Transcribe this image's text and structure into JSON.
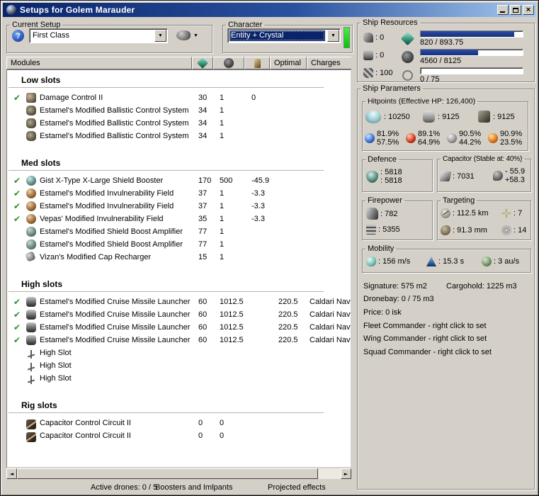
{
  "window": {
    "title": "Setups for Golem Marauder"
  },
  "colors": {
    "title_gradient_start": "#0a246a",
    "title_gradient_end": "#a6caf0",
    "selection": "#0a246a",
    "progress_fill": "#1c3c94",
    "status_green": "#00c800",
    "check_green": "#2e8f2e",
    "window_bg": "#d4d0c8"
  },
  "current_setup": {
    "label": "Current Setup",
    "value": "First Class"
  },
  "character": {
    "label": "Character",
    "value": "Entity + Crystal"
  },
  "columns": {
    "modules": "Modules",
    "optimal": "Optimal",
    "charges": "Charges"
  },
  "modules": {
    "check_glyph": "✔",
    "sections": [
      {
        "title": "Low slots",
        "rows": [
          {
            "fitted": true,
            "icon": "damage-control",
            "name": "Damage Control II",
            "cpu": "30",
            "pg": "1",
            "cap": "0"
          },
          {
            "fitted": false,
            "icon": "ballistic-control",
            "name": "Estamel's Modified Ballistic Control System",
            "cpu": "34",
            "pg": "1"
          },
          {
            "fitted": false,
            "icon": "ballistic-control",
            "name": "Estamel's Modified Ballistic Control System",
            "cpu": "34",
            "pg": "1"
          },
          {
            "fitted": false,
            "icon": "ballistic-control",
            "name": "Estamel's Modified Ballistic Control System",
            "cpu": "34",
            "pg": "1"
          }
        ]
      },
      {
        "title": "Med slots",
        "rows": [
          {
            "fitted": true,
            "icon": "shield-booster",
            "name": "Gist X-Type X-Large Shield Booster",
            "cpu": "170",
            "pg": "500",
            "cap": "-45.9"
          },
          {
            "fitted": true,
            "icon": "invuln-field",
            "name": "Estamel's Modified Invulnerability Field",
            "cpu": "37",
            "pg": "1",
            "cap": "-3.3"
          },
          {
            "fitted": true,
            "icon": "invuln-field",
            "name": "Estamel's Modified Invulnerability Field",
            "cpu": "37",
            "pg": "1",
            "cap": "-3.3"
          },
          {
            "fitted": true,
            "icon": "invuln-field",
            "name": "Vepas' Modified Invulnerability Field",
            "cpu": "35",
            "pg": "1",
            "cap": "-3.3"
          },
          {
            "fitted": false,
            "icon": "boost-amplifier",
            "name": "Estamel's Modified Shield Boost Amplifier",
            "cpu": "77",
            "pg": "1"
          },
          {
            "fitted": false,
            "icon": "boost-amplifier",
            "name": "Estamel's Modified Shield Boost Amplifier",
            "cpu": "77",
            "pg": "1"
          },
          {
            "fitted": false,
            "icon": "cap-recharger",
            "name": "Vizan's Modified Cap Recharger",
            "cpu": "15",
            "pg": "1"
          }
        ]
      },
      {
        "title": "High slots",
        "rows": [
          {
            "fitted": true,
            "icon": "missile-launcher",
            "name": "Estamel's Modified Cruise Missile Launcher",
            "cpu": "60",
            "pg": "1012.5",
            "optimal": "220.5",
            "charge": "Caldari Navy"
          },
          {
            "fitted": true,
            "icon": "missile-launcher",
            "name": "Estamel's Modified Cruise Missile Launcher",
            "cpu": "60",
            "pg": "1012.5",
            "optimal": "220.5",
            "charge": "Caldari Navy"
          },
          {
            "fitted": true,
            "icon": "missile-launcher",
            "name": "Estamel's Modified Cruise Missile Launcher",
            "cpu": "60",
            "pg": "1012.5",
            "optimal": "220.5",
            "charge": "Caldari Navy"
          },
          {
            "fitted": true,
            "icon": "missile-launcher",
            "name": "Estamel's Modified Cruise Missile Launcher",
            "cpu": "60",
            "pg": "1012.5",
            "optimal": "220.5",
            "charge": "Caldari Navy"
          },
          {
            "fitted": false,
            "icon": "empty-slot",
            "name": "High Slot"
          },
          {
            "fitted": false,
            "icon": "empty-slot",
            "name": "High Slot"
          },
          {
            "fitted": false,
            "icon": "empty-slot",
            "name": "High Slot"
          }
        ]
      },
      {
        "title": "Rig slots",
        "rows": [
          {
            "fitted": false,
            "icon": "rig",
            "name": "Capacitor Control Circuit II",
            "cpu": "0",
            "pg": "0"
          },
          {
            "fitted": false,
            "icon": "rig",
            "name": "Capacitor Control Circuit II",
            "cpu": "0",
            "pg": "0"
          }
        ]
      }
    ]
  },
  "ship_resources": {
    "label": "Ship Resources",
    "hardpoints": [
      {
        "icon": "turret-hardpoint",
        "value": ": 0"
      },
      {
        "icon": "launcher-hardpoint",
        "value": ": 0"
      },
      {
        "icon": "rigpoints",
        "value": ": 100"
      }
    ],
    "bars": [
      {
        "icon": "cpu",
        "text": "820 / 893.75",
        "pct": 91.7
      },
      {
        "icon": "powergrid",
        "text": "4560 / 8125",
        "pct": 56.1
      },
      {
        "icon": "calibration",
        "text": "0 / 75",
        "pct": 0
      }
    ]
  },
  "ship_parameters": {
    "label": "Ship Parameters",
    "hitpoints": {
      "label": "Hitpoints (Effective HP: 126,400)",
      "shield": ": 10250",
      "armor": ": 9125",
      "structure": ": 9125",
      "resists": [
        {
          "name": "em",
          "shield": "81.9%",
          "armor": "57.5%"
        },
        {
          "name": "thermal",
          "shield": "89.1%",
          "armor": "64.9%"
        },
        {
          "name": "kinetic",
          "shield": "90.5%",
          "armor": "44.2%"
        },
        {
          "name": "explosive",
          "shield": "90.9%",
          "armor": "23.5%"
        }
      ]
    },
    "defence": {
      "label": "Defence",
      "v1": ": 5818",
      "v2": ": 5818"
    },
    "capacitor": {
      "label": "Capacitor (Stable at: 40%)",
      "amount": ": 7031",
      "out": "- 55.9",
      "in": "+58.3"
    },
    "firepower": {
      "label": "Firepower",
      "volley": ": 782",
      "dps": ": 5355"
    },
    "targeting": {
      "label": "Targeting",
      "range": ": 112.5 km",
      "max_targets": ": 7",
      "scan_res": ": 91.3 mm",
      "sensor_strength": ": 14"
    },
    "mobility": {
      "label": "Mobility",
      "speed": ": 156 m/s",
      "align": ": 15.3 s",
      "warp": ": 3 au/s"
    },
    "info": {
      "signature": "Signature: 575 m2",
      "cargohold": "Cargohold: 1225 m3",
      "dronebay": "Dronebay: 0 / 75 m3",
      "price": "Price: 0 isk",
      "fleet": "Fleet Commander - right click to set",
      "wing": "Wing Commander - right click to set",
      "squad": "Squad Commander - right click to set"
    }
  },
  "bottom": {
    "drones": "Active drones: 0 / 5",
    "boosters": "Boosters and Imlpants",
    "projected": "Projected effects"
  }
}
